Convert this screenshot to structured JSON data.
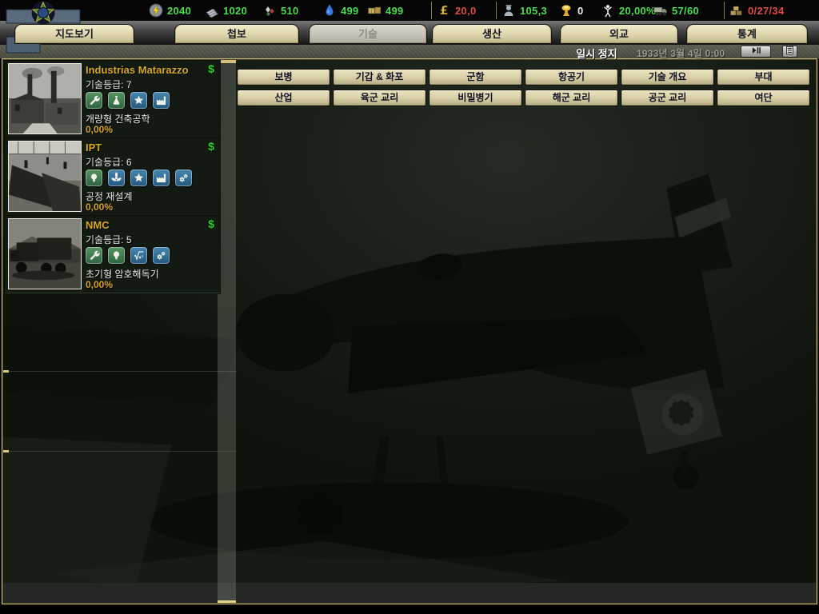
{
  "topbar": {
    "resources": [
      {
        "name": "energy",
        "icon": "energy-icon",
        "value": "2040",
        "color": "#47e047"
      },
      {
        "name": "metal",
        "icon": "metal-icon",
        "value": "1020",
        "color": "#47e047"
      },
      {
        "name": "rare-materials",
        "icon": "rares-icon",
        "value": "510",
        "color": "#47e047"
      },
      {
        "name": "oil",
        "icon": "oil-icon",
        "value": "499",
        "color": "#47e047"
      },
      {
        "name": "supplies",
        "icon": "supplies-icon",
        "value": "499",
        "color": "#47e047",
        "sep_after": true
      },
      {
        "name": "money",
        "icon": "money-icon",
        "value": "20,0",
        "color": "#e34b3b",
        "sep_after": true
      },
      {
        "name": "manpower",
        "icon": "manpower-icon",
        "value": "105,3",
        "color": "#47e047"
      },
      {
        "name": "nukes",
        "icon": "nuke-icon",
        "value": "0",
        "color": "#f2f2f2"
      },
      {
        "name": "dissent",
        "icon": "dissent-icon",
        "value": "20,00%",
        "color": "#47e047"
      },
      {
        "name": "transport-capacity",
        "icon": "truck-icon",
        "value": "57/60",
        "color": "#47e047",
        "sep_after": true
      },
      {
        "name": "convoys",
        "icon": "convoy-icon",
        "value": "0/27/34",
        "color": "#e34b3b"
      }
    ]
  },
  "tabs": [
    {
      "id": "map",
      "label": "지도보기",
      "selected": false
    },
    {
      "id": "intelligence",
      "label": "첩보",
      "selected": false
    },
    {
      "id": "technology",
      "label": "기술",
      "selected": true
    },
    {
      "id": "production",
      "label": "생산",
      "selected": false
    },
    {
      "id": "diplomacy",
      "label": "외교",
      "selected": false
    },
    {
      "id": "statistics",
      "label": "통계",
      "selected": false
    }
  ],
  "statusbar": {
    "pause_label": "일시 정지",
    "date": "1933년 3월 4일 0:00"
  },
  "research_teams": [
    {
      "name": "Industrias Matarazzo",
      "funding_symbol": "$",
      "skill_label": "기술등급: 7",
      "photo": "factory-photo",
      "specialties": [
        "wrench-icon",
        "flask-icon",
        "star-icon",
        "factory-icon"
      ],
      "project": "개량형 건축공학",
      "progress": "0,00%"
    },
    {
      "name": "IPT",
      "funding_symbol": "$",
      "skill_label": "기술등급: 6",
      "photo": "workshop-photo",
      "specialties": [
        "bulb-icon",
        "propeller-icon",
        "star-icon",
        "factory-icon",
        "gears-icon"
      ],
      "project": "공정 재설계",
      "progress": "0,00%"
    },
    {
      "name": "NMC",
      "funding_symbol": "$",
      "skill_label": "기술등급: 5",
      "photo": "truck-photo",
      "specialties": [
        "wrench-icon",
        "bulb-icon",
        "math-icon",
        "gears-icon"
      ],
      "project": "초기형 암호해독기",
      "progress": "0,00%"
    }
  ],
  "tech_buttons": {
    "row1": [
      "보병",
      "기갑 & 화포",
      "군함",
      "항공기",
      "기술 개요",
      "부대"
    ],
    "row2": [
      "산업",
      "육군 교리",
      "비밀병기",
      "해군 교리",
      "공군 교리",
      "여단"
    ]
  },
  "colors": {
    "resource_green": "#47e047",
    "resource_red": "#e34b3b",
    "team_name_gold": "#d9a91f",
    "progress_yellow": "#daa41a",
    "button_beige": "#ddd4ab"
  }
}
